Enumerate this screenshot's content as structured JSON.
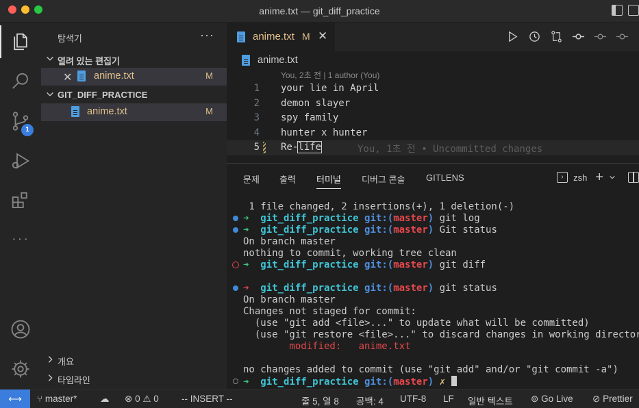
{
  "window": {
    "title": "anime.txt — git_diff_practice"
  },
  "activity": {
    "scm_badge": "1"
  },
  "sidebar": {
    "title": "탐색기",
    "more": "···",
    "open_editors": {
      "label": "열려 있는 편집기",
      "items": [
        {
          "name": "anime.txt",
          "status": "M"
        }
      ]
    },
    "project": {
      "label": "GIT_DIFF_PRACTICE",
      "items": [
        {
          "name": "anime.txt",
          "status": "M"
        }
      ]
    },
    "outline_label": "개요",
    "timeline_label": "타임라인"
  },
  "editor": {
    "tab": {
      "name": "anime.txt",
      "status": "M"
    },
    "breadcrumb": "anime.txt",
    "blame_header": "You, 2초 전 | 1 author (You)",
    "lines": [
      {
        "num": "1",
        "text": "your lie in April"
      },
      {
        "num": "2",
        "text": "demon slayer"
      },
      {
        "num": "3",
        "text": "spy family"
      },
      {
        "num": "4",
        "text": "hunter x hunter"
      },
      {
        "num": "5",
        "text_before": "Re-",
        "text_cursor": "life",
        "inline_blame": "You, 1초 전 • Uncommitted changes"
      }
    ]
  },
  "panel": {
    "tabs": [
      "문제",
      "출력",
      "터미널",
      "디버그 콘솔",
      "GITLENS"
    ],
    "active_tab": "터미널",
    "shell": "zsh",
    "terminal": {
      "summary": " 1 file changed, 2 insertions(+), 1 deletion(-)",
      "prompt_dir": "git_diff_practice",
      "git_label": "git:(",
      "branch": "master",
      "git_close": ")",
      "cmd1": " git log",
      "cmd2": " Git status",
      "out_branch": "On branch master",
      "out_clean": "nothing to commit, working tree clean",
      "cmd3": " git diff",
      "cmd4": " git status",
      "out_branch2": "On branch master",
      "out_not_staged": "Changes not staged for commit:",
      "out_hint1": "  (use \"git add <file>...\" to update what will be committed)",
      "out_hint2": "  (use \"git restore <file>...\" to discard changes in working directory)",
      "out_modified_label": "        modified:   ",
      "out_modified_file": "anime.txt",
      "out_no_changes": "no changes added to commit (use \"git add\" and/or \"git commit -a\")",
      "dirty_mark": " ✗ "
    }
  },
  "statusbar": {
    "branch": "master*",
    "errors": "0",
    "warnings": "0",
    "mode": "-- INSERT --",
    "position": "줄 5, 열 8",
    "spaces": "공백: 4",
    "encoding": "UTF-8",
    "eol": "LF",
    "language": "일반 텍스트",
    "golive": "Go Live",
    "prettier": "Prettier"
  },
  "colors": {
    "accent": "#3b7ddd",
    "modified": "#e2c08d",
    "terminal_green": "#3ec983",
    "terminal_cyan": "#3fc5d6",
    "terminal_red": "#e5484d"
  }
}
